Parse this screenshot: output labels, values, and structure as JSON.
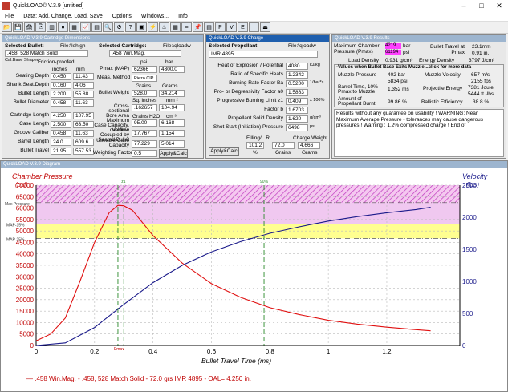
{
  "window": {
    "title": "QuickLOAD© V.3.9  [untitled]",
    "min": "–",
    "max": "□",
    "close": "✕"
  },
  "menu": [
    "File",
    "Data: Add, Change, Load, Save",
    "Options",
    "Windows...",
    "Info"
  ],
  "toolbar_icons": [
    "open-icon",
    "save-icon",
    "print-icon",
    "copy-icon",
    "cartridge-icon",
    "bullet-icon",
    "powder-icon",
    "chart-icon",
    "table-icon",
    "zoom-icon",
    "settings-icon",
    "help-icon",
    "calc-icon",
    "bolt-icon",
    "flame-icon",
    "grid-icon",
    "list-icon",
    "pin-icon",
    "report-icon",
    "pressure-icon",
    "velocity-icon",
    "energy-icon",
    "info-icon",
    "exit-icon"
  ],
  "cartridge": {
    "head": "QuickLOAD V.3.9 Cartridge Dimensions",
    "sel_bullet": "Selected Bullet:",
    "file_bullet": "File:\\lehigh",
    "bullet": ".458, 528 Match Solid",
    "cal_base": "Cal.Base Shaped",
    "friction": "Friction-proofed",
    "inches": "inches",
    "mm": "mm",
    "rows": [
      {
        "l": "Seating Depth",
        "in": "0.450",
        "mm": "11.43"
      },
      {
        "l": "Shank Seat.Depth",
        "in": "0.160",
        "mm": "4.06"
      },
      {
        "l": "Bullet Length",
        "in": "2.200",
        "mm": "55.88"
      },
      {
        "l": "Bullet Diameter",
        "in": "0.458",
        "mm": "11.63"
      }
    ],
    "rows2": [
      {
        "l": "Cartridge Length",
        "in": "4.250",
        "mm": "107.95"
      },
      {
        "l": "Case Length",
        "in": "2.500",
        "mm": "63.50"
      },
      {
        "l": "Groove Caliber",
        "in": "0.458",
        "mm": "11.63"
      },
      {
        "l": "Barrel Length",
        "in": "24.0",
        "mm": "609.6"
      },
      {
        "l": "Bullet Travel",
        "in": "21.95",
        "mm": "557.53"
      }
    ],
    "sel_cart": "Selected Cartridge:",
    "file_cart": "File:\\qloadw",
    "cart": ".458 Win.Mag.",
    "psi": "psi",
    "bar": "bar",
    "pmax_l": "Pmax (MAP)",
    "pmax_psi": "62366",
    "pmax_bar": "4300.0",
    "meas_l": "Meas. Method",
    "meas": "Piezo CIP",
    "grains": "Grains",
    "grams": "Grams",
    "bw_l": "Bullet Weight",
    "bw_gr": "528.0",
    "bw_g": "34.214",
    "sq_in": "Sq. inches",
    "mm2": "mm ²",
    "csa_l": "Cross-sectional Bore Area",
    "csa_in": ".162657",
    "csa_mm": "104.94",
    "h2o": "Grains H2O",
    "cm3": "cm ³",
    "mcc_l": "Maximum Case Capacity, overflow",
    "mcc_gr": "95.00",
    "mcc_cm": "6.168",
    "vol_l": "Volume Occupied by Seated Bullet",
    "vol_gr": "17.767",
    "vol_cm": "1.154",
    "ucc_l": "Useable Case Capacity",
    "ucc_gr": "77.229",
    "ucc_cm": "5.014",
    "wf_l": "Weighting Factor",
    "wf": "0.5",
    "apply": "Apply&Calc"
  },
  "charge": {
    "head": "QuickLOAD V.3.9 Charge",
    "sel": "Selected Propellant:",
    "file": "File:\\qloadw",
    "prop": "IMR 4895",
    "rows": [
      {
        "l": "Heat of Explosion / Potential",
        "v": "4080",
        "u": "kJ/kg"
      },
      {
        "l": "Ratio of Specific Heats",
        "v": "1.2342",
        "u": ""
      },
      {
        "l": "Burning Rate Factor  Ba",
        "v": "0.5200",
        "u": "1/bar*s"
      },
      {
        "l": "Pro- or Degressivity Factor  a0",
        "v": "1.5863",
        "u": ""
      },
      {
        "l": "Progressive Burning Limit z1",
        "v": "0.409",
        "u": "x 100%"
      },
      {
        "l": "Factor  b",
        "v": "1.6703",
        "u": ""
      },
      {
        "l": "Propellant Solid Density",
        "v": "1.620",
        "u": "g/cm³"
      },
      {
        "l": "Shot Start (Initiation) Pressure",
        "v": "6498",
        "u": "psi"
      }
    ],
    "apply": "Apply&Calc",
    "fill_l": "Filling/L.R.",
    "cw_l": "Charge Weight",
    "fill": "101.2",
    "cw_gr": "72.0",
    "cw_g": "4.666",
    "pct": "%",
    "gr": "Grains",
    "g": "Grams"
  },
  "results": {
    "head": "QuickLOAD V.3.9 Results",
    "mcp_l": "Maximum Chamber Pressure (Pmax)",
    "mcp_bar": "4219",
    "mcp_psi": "61194",
    "bar": "bar",
    "psi": "psi",
    "bt_l": "Bullet Travel at Pmax",
    "bt1": "23.1mm",
    "bt2": "0.91 in.",
    "ld_l": "Load Density",
    "ld": "0.931 g/cm³",
    "ed_l": "Energy Density",
    "ed": "3797 J/cm³",
    "exit_h": "-Values when Bullet Base Exits Muzzle...click for more data",
    "mp_l": "Muzzle Pressure",
    "mp1": "402 bar",
    "mp2": "5834 psi",
    "mv_l": "Muzzle Velocity",
    "mv1": "657 m/s",
    "mv2": "2155 fps",
    "bt_l2": "Barrel Time, 10% Pmax to Muzzle",
    "bt": "1.352 ms",
    "pe_l": "Projectile Energy",
    "pe1": "7381 Joule",
    "pe2": "5444 ft.-lbs",
    "ap_l": "Amount of Propellant Burnt",
    "ap": "99.86 %",
    "be_l": "Ballistic Efficiency",
    "be": "38.8 %",
    "msg": "Results without any guarantee on usability !  WARNING: Near Maximum Average Pressure - tolerances may cause dangerous pressures !  Warning : 1.2% compressed charge !  End of"
  },
  "diagram": {
    "head": "QuickLOAD V.3.9 Diagram",
    "cp": "Chamber Pressure",
    "psi": "(psi)",
    "vel": "Velocity",
    "fps": "(fps)",
    "map15": "MAP-15%",
    "map25": "MAP-25%",
    "maxp": "Max Pressure",
    "z1": "z1",
    "p90": "90%",
    "pmax": "Pmax",
    "xlabel": "Bullet Travel Time (ms)",
    "legend": "— .458 Win.Mag. - .458, 528 Match Solid - 72.0 grs IMR 4895 - OAL= 4.250 in."
  },
  "chart_data": {
    "type": "line",
    "xlabel": "Bullet Travel Time (ms)",
    "ylabel": "Chamber Pressure (psi)",
    "y2label": "Velocity (fps)",
    "xlim": [
      0,
      1.45
    ],
    "ylim": [
      0,
      70000
    ],
    "y2lim": [
      0,
      2500
    ],
    "xticks": [
      "0",
      "0.2",
      "0.4",
      "0.6",
      "0.8",
      "1",
      "1.2"
    ],
    "yticks": [
      "0",
      "5000",
      "10000",
      "15000",
      "20000",
      "25000",
      "30000",
      "35000",
      "40000",
      "45000",
      "50000",
      "55000",
      "60000",
      "65000",
      "70000"
    ],
    "y2ticks": [
      "0",
      "500",
      "1000",
      "1500",
      "2000",
      "2500"
    ],
    "series": [
      {
        "color": "#e01010",
        "x": [
          0,
          0.05,
          0.1,
          0.15,
          0.2,
          0.25,
          0.28,
          0.3,
          0.33,
          0.4,
          0.5,
          0.6,
          0.7,
          0.8,
          0.9,
          1.0,
          1.1,
          1.2,
          1.3,
          1.35
        ],
        "values": [
          2000,
          5000,
          12000,
          28000,
          45000,
          58000,
          61194,
          61000,
          59000,
          48000,
          36000,
          27000,
          21000,
          16500,
          13500,
          11000,
          9300,
          8000,
          6900,
          6400
        ]
      },
      {
        "color": "#1a1a8a",
        "x": [
          0,
          0.1,
          0.2,
          0.3,
          0.4,
          0.5,
          0.6,
          0.7,
          0.8,
          0.9,
          1.0,
          1.1,
          1.2,
          1.3,
          1.35
        ],
        "values": [
          0,
          40,
          280,
          640,
          980,
          1250,
          1460,
          1620,
          1750,
          1850,
          1940,
          2010,
          2070,
          2120,
          2155
        ]
      }
    ]
  }
}
